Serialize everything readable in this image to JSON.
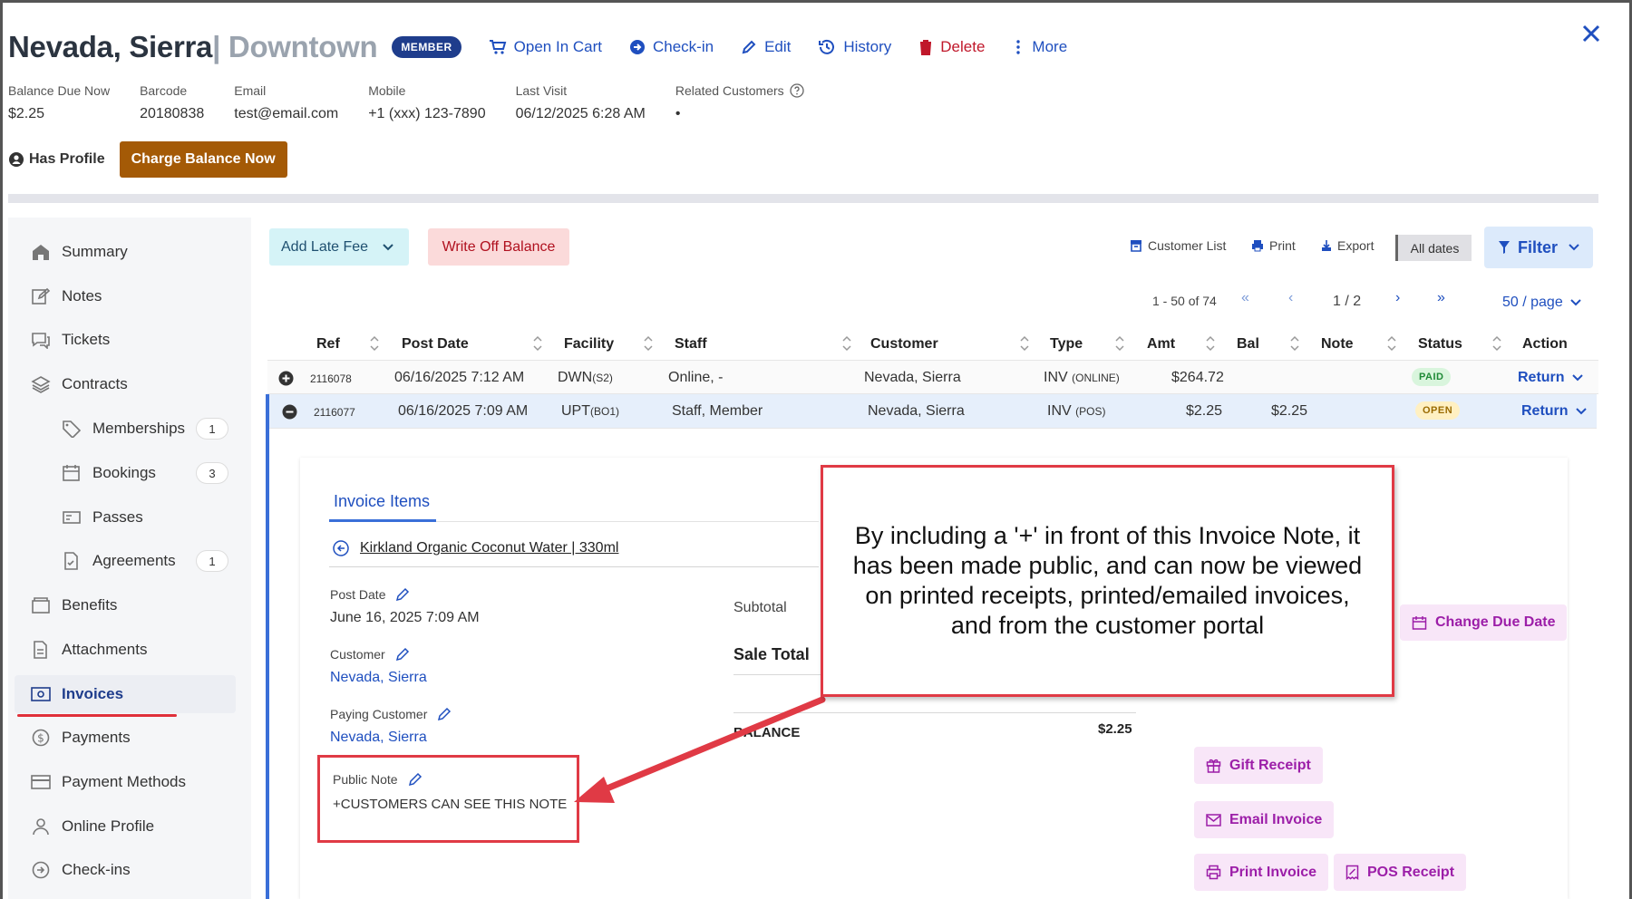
{
  "header": {
    "name": "Nevada, Sierra",
    "location": "| Downtown",
    "badge": "MEMBER",
    "actions": {
      "open_in_cart": "Open In Cart",
      "check_in": "Check-in",
      "edit": "Edit",
      "history": "History",
      "delete": "Delete",
      "more": "More"
    }
  },
  "info": {
    "balance_label": "Balance Due Now",
    "balance_value": "$2.25",
    "barcode_label": "Barcode",
    "barcode_value": "20180838",
    "email_label": "Email",
    "email_value": "test@email.com",
    "mobile_label": "Mobile",
    "mobile_value": "+1 (xxx) 123-7890",
    "last_visit_label": "Last Visit",
    "last_visit_value": "06/12/2025 6:28 AM",
    "related_label": "Related Customers",
    "related_value": "•"
  },
  "profile": {
    "has_profile": "Has Profile",
    "charge_button": "Charge Balance Now"
  },
  "sidebar": {
    "items": [
      {
        "label": "Summary"
      },
      {
        "label": "Notes"
      },
      {
        "label": "Tickets"
      },
      {
        "label": "Contracts"
      },
      {
        "label": "Memberships",
        "count": "1"
      },
      {
        "label": "Bookings",
        "count": "3"
      },
      {
        "label": "Passes"
      },
      {
        "label": "Agreements",
        "count": "1"
      },
      {
        "label": "Benefits"
      },
      {
        "label": "Attachments"
      },
      {
        "label": "Invoices"
      },
      {
        "label": "Payments"
      },
      {
        "label": "Payment Methods"
      },
      {
        "label": "Online Profile"
      },
      {
        "label": "Check-ins"
      }
    ]
  },
  "toolbar": {
    "add_late_fee": "Add Late Fee",
    "write_off": "Write Off Balance",
    "customer_list": "Customer List",
    "print": "Print",
    "export": "Export",
    "all_dates": "All dates",
    "filter": "Filter"
  },
  "pager": {
    "range": "1 - 50 of 74",
    "page": "1 / 2",
    "per_page": "50 / page"
  },
  "table": {
    "headers": [
      "Ref",
      "Post Date",
      "Facility",
      "Staff",
      "Customer",
      "Type",
      "Amt",
      "Bal",
      "Note",
      "Status",
      "Action"
    ],
    "rows": [
      {
        "ref": "2116078",
        "post_date": "06/16/2025 7:12 AM",
        "facility": "DWN",
        "facility_sub": "(S2)",
        "staff": "Online, -",
        "customer": "Nevada, Sierra",
        "type": "INV",
        "type_sub": "(ONLINE)",
        "amt": "$264.72",
        "bal": "",
        "note": "",
        "status": "PAID",
        "action": "Return"
      },
      {
        "ref": "2116077",
        "post_date": "06/16/2025 7:09 AM",
        "facility": "UPT",
        "facility_sub": "(BO1)",
        "staff": "Staff, Member",
        "customer": "Nevada, Sierra",
        "type": "INV",
        "type_sub": "(POS)",
        "amt": "$2.25",
        "bal": "$2.25",
        "note": "",
        "status": "OPEN",
        "action": "Return"
      }
    ]
  },
  "invoice": {
    "tab": "Invoice Items",
    "item": "Kirkland Organic Coconut Water | 330ml",
    "post_date_label": "Post Date",
    "post_date_value": "June 16, 2025 7:09 AM",
    "customer_label": "Customer",
    "customer_value": "Nevada, Sierra",
    "paying_label": "Paying Customer",
    "paying_value": "Nevada, Sierra",
    "note_label": "Public Note",
    "note_value": "+CUSTOMERS CAN SEE THIS NOTE",
    "subtotal_label": "Subtotal",
    "sale_total_label": "Sale Total",
    "balance_label": "BALANCE",
    "balance_value": "$2.25",
    "change_due_date": "Change Due Date",
    "gift_receipt": "Gift Receipt",
    "email_invoice": "Email Invoice",
    "print_invoice": "Print Invoice",
    "pos_receipt": "POS Receipt"
  },
  "callout": {
    "text": "By including a '+' in front of this Invoice Note, it has been made public, and can now be viewed on printed receipts, printed/emailed invoices, and from the customer portal"
  },
  "colors": {
    "primary": "#1f4fbf",
    "member_badge": "#1f3d8c",
    "charge_button": "#a45a06",
    "delete": "#c0172a",
    "annotation": "#e03a45",
    "pill_bg": "#f8e6f8",
    "pill_text": "#9c1ea8"
  }
}
